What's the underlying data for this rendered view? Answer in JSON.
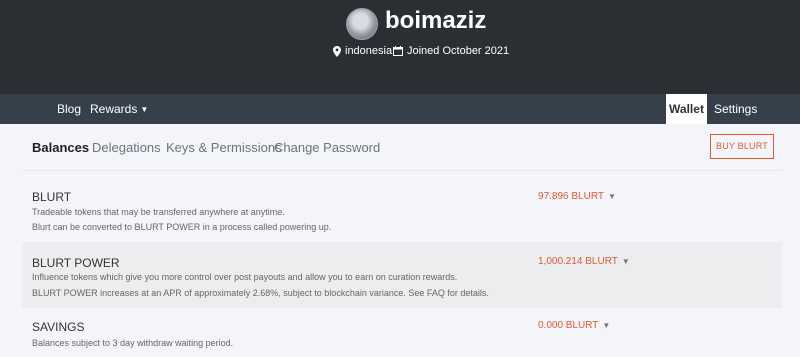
{
  "profile": {
    "username": "boimaziz",
    "location": "indonesia",
    "joined": "Joined October 2021"
  },
  "nav": {
    "blog": "Blog",
    "rewards": "Rewards",
    "wallet": "Wallet",
    "settings": "Settings"
  },
  "tabs": {
    "balances": "Balances",
    "delegations": "Delegations",
    "keys": "Keys & Permissions",
    "password": "Change Password"
  },
  "buy_button": "BUY BLURT",
  "balances": [
    {
      "title": "BLURT",
      "desc1": "Tradeable tokens that may be transferred anywhere at anytime.",
      "desc2": "Blurt can be converted to BLURT POWER in a process called powering up.",
      "value": "97.896 BLURT"
    },
    {
      "title": "BLURT POWER",
      "desc1": "Influence tokens which give you more control over post payouts and allow you to earn on curation rewards.",
      "desc2": "BLURT POWER increases at an APR of approximately 2.68%, subject to blockchain variance. See FAQ for details.",
      "value": "1,000.214 BLURT"
    },
    {
      "title": "SAVINGS",
      "desc1": "Balances subject to 3 day withdraw waiting period.",
      "value": "0.000 BLURT"
    }
  ],
  "colors": {
    "accent": "#e0592f",
    "header_bg": "#2b2f33",
    "nav_bg": "#36404a"
  },
  "icons": [
    "map-pin-icon",
    "calendar-icon",
    "caret-down-icon"
  ]
}
